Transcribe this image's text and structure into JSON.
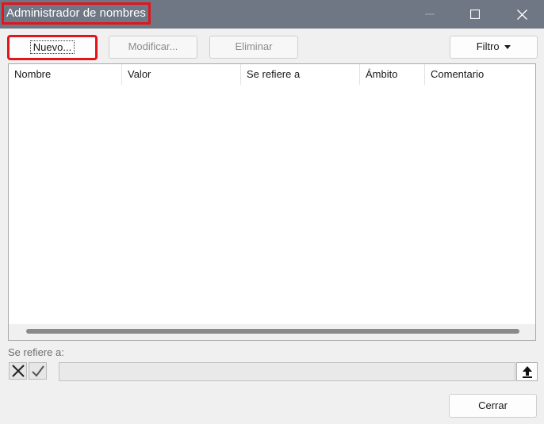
{
  "window": {
    "title": "Administrador de nombres",
    "controls": [
      "minimize-icon",
      "maximize-icon",
      "close-icon"
    ],
    "title_bar_color": "#6f7785",
    "highlight_color": "#e3141b"
  },
  "toolbar": {
    "new_label": "Nuevo...",
    "edit_label": "Modificar...",
    "delete_label": "Eliminar",
    "filter_label": "Filtro",
    "filter_icon": "caret-down-icon"
  },
  "table": {
    "columns": [
      "Nombre",
      "Valor",
      "Se refiere a",
      "Ámbito",
      "Comentario"
    ],
    "rows": []
  },
  "refers_to": {
    "label": "Se refiere a:",
    "cancel_icon": "x-icon",
    "confirm_icon": "check-icon",
    "value": "",
    "collapse_icon": "upload-arrow-icon"
  },
  "footer": {
    "close_label": "Cerrar"
  }
}
